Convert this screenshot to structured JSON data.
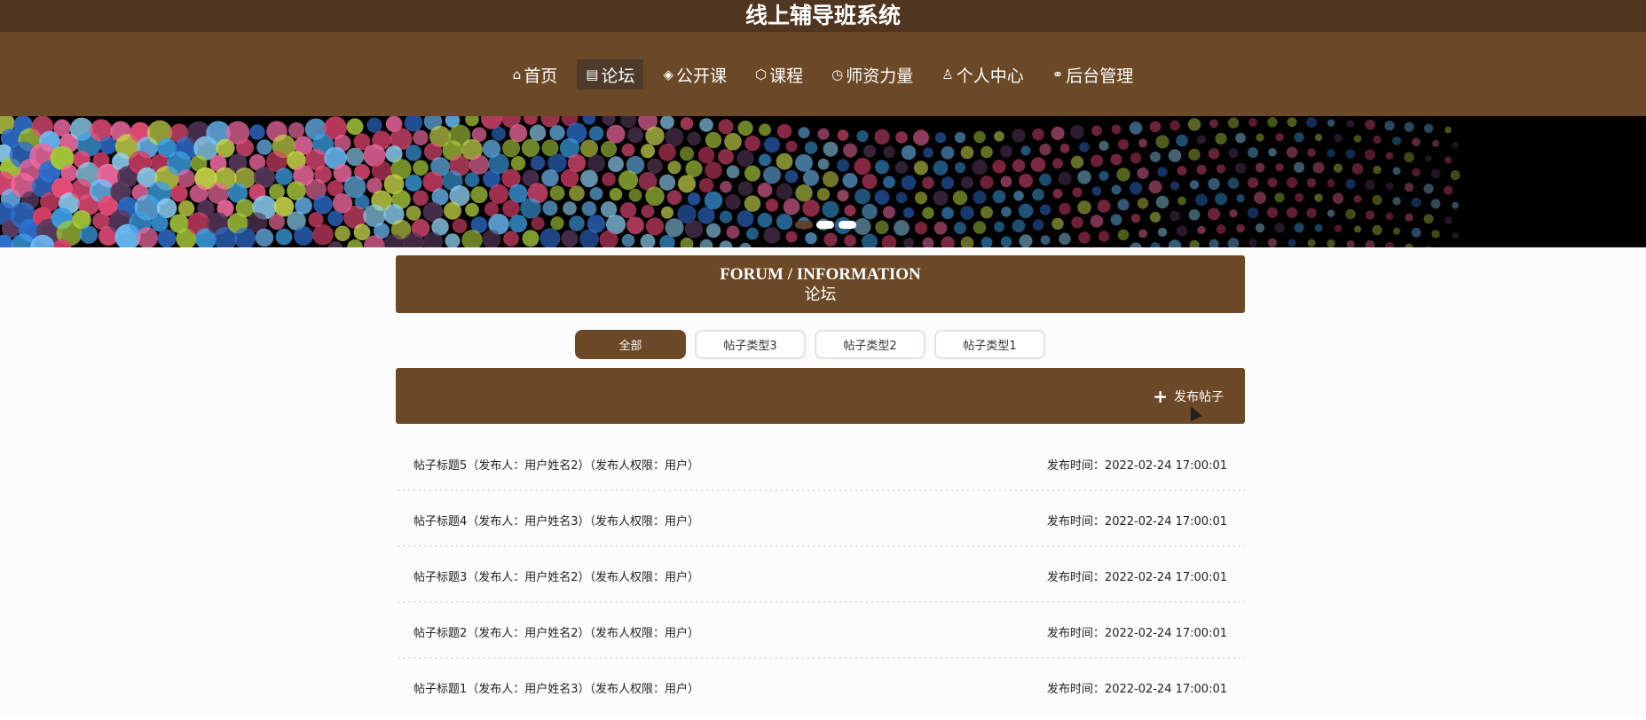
{
  "header": {
    "title": "线上辅导班系统",
    "nav": [
      {
        "icon": "home-icon",
        "glyph": "⌂",
        "label": "首页",
        "active": false
      },
      {
        "icon": "forum-icon",
        "glyph": "▤",
        "label": "论坛",
        "active": true
      },
      {
        "icon": "open-course-icon",
        "glyph": "◈",
        "label": "公开课",
        "active": false
      },
      {
        "icon": "course-icon",
        "glyph": "⬡",
        "label": "课程",
        "active": false
      },
      {
        "icon": "teacher-icon",
        "glyph": "◷",
        "label": "师资力量",
        "active": false
      },
      {
        "icon": "user-icon",
        "glyph": "♙",
        "label": "个人中心",
        "active": false
      },
      {
        "icon": "link-icon",
        "glyph": "⚭",
        "label": "后台管理",
        "active": false
      }
    ]
  },
  "banner": {
    "slide_count": 3,
    "active_slide": 1
  },
  "section": {
    "title_en": "FORUM / INFORMATION",
    "title_zh": "论坛"
  },
  "tabs": [
    {
      "label": "全部",
      "active": true
    },
    {
      "label": "帖子类型3",
      "active": false
    },
    {
      "label": "帖子类型2",
      "active": false
    },
    {
      "label": "帖子类型1",
      "active": false
    }
  ],
  "toolbar": {
    "publish_label": "发布帖子"
  },
  "posts": [
    {
      "title": "帖子标题5（发布人：用户姓名2）（发布人权限：用户）",
      "time": "发布时间：2022-02-24 17:00:01"
    },
    {
      "title": "帖子标题4（发布人：用户姓名3）（发布人权限：用户）",
      "time": "发布时间：2022-02-24 17:00:01"
    },
    {
      "title": "帖子标题3（发布人：用户姓名2）（发布人权限：用户）",
      "time": "发布时间：2022-02-24 17:00:01"
    },
    {
      "title": "帖子标题2（发布人：用户姓名2）（发布人权限：用户）",
      "time": "发布时间：2022-02-24 17:00:01"
    },
    {
      "title": "帖子标题1（发布人：用户姓名3）（发布人权限：用户）",
      "time": "发布时间：2022-02-24 17:00:01"
    }
  ],
  "colors": {
    "brand": "#6b4826",
    "header_top": "#503520",
    "active_nav": "#4e3a2b"
  }
}
